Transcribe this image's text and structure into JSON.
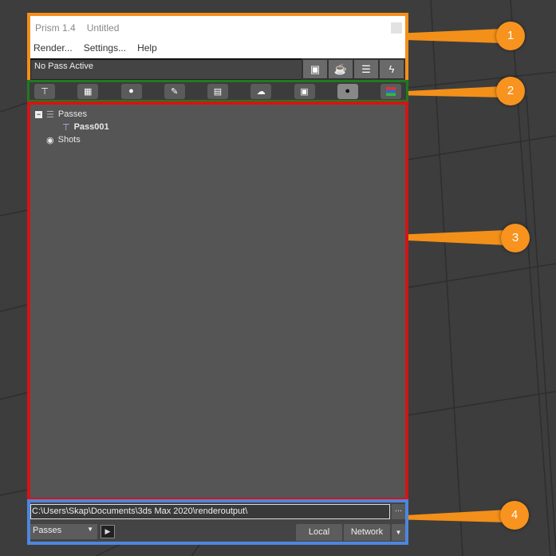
{
  "window": {
    "app": "Prism 1.4",
    "file": "Untitled"
  },
  "menu": [
    "Render...",
    "Settings...",
    "Help"
  ],
  "status": "No Pass Active",
  "top_buttons": [
    "render-preview-icon",
    "teapot-icon",
    "layers-icon",
    "lightning-icon"
  ],
  "toolbar_icons": [
    "hierarchy-icon",
    "objects-icon",
    "sphere-icon",
    "light-icon",
    "settings-panel-icon",
    "environment-icon",
    "render-frame-icon",
    "camera-dot-icon",
    "color-layers-icon"
  ],
  "tree": {
    "passes": "Passes",
    "pass": "Pass001",
    "shots": "Shots"
  },
  "output_path": "C:\\Users\\Skap\\Documents\\3ds Max 2020\\renderoutput\\",
  "browse_label": "...",
  "mode_select": "Passes",
  "local_label": "Local",
  "network_label": "Network",
  "callouts": [
    "1",
    "2",
    "3",
    "4"
  ],
  "colors": {
    "section1": "#f39019",
    "section2": "#1f7a1f",
    "section3": "#d41414",
    "section4": "#4e86de",
    "callout": "#f7931e"
  }
}
